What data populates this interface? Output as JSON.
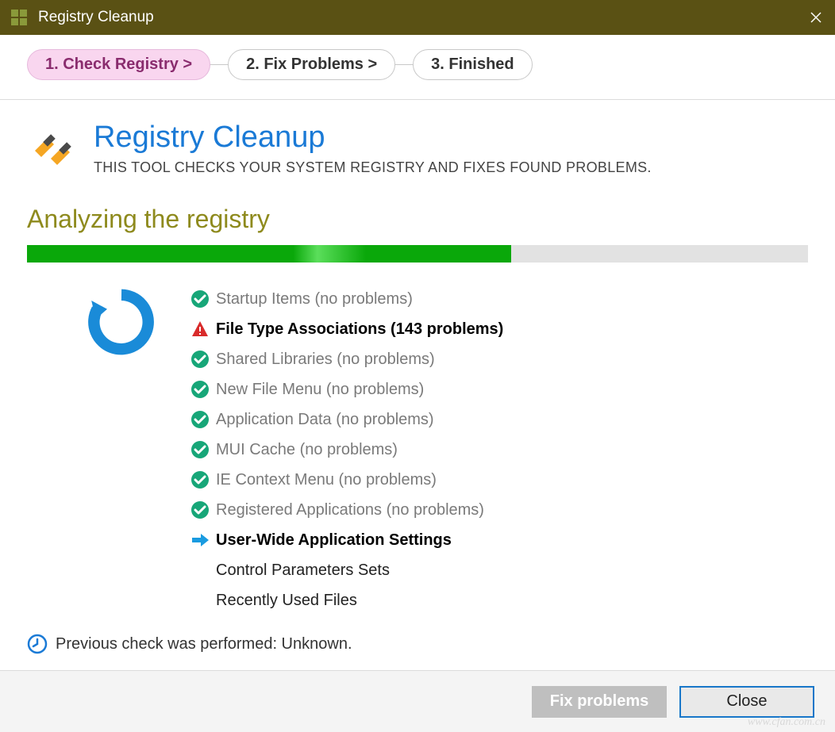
{
  "titlebar": {
    "title": "Registry Cleanup"
  },
  "steps": [
    {
      "label": "1. Check Registry >",
      "active": true
    },
    {
      "label": "2. Fix Problems >",
      "active": false
    },
    {
      "label": "3. Finished",
      "active": false
    }
  ],
  "header": {
    "title": "Registry Cleanup",
    "subtitle": "THIS TOOL CHECKS YOUR SYSTEM REGISTRY AND FIXES FOUND PROBLEMS."
  },
  "status_heading": "Analyzing the registry",
  "progress_percent": 62,
  "items": [
    {
      "label": "Startup Items (no problems)",
      "state": "ok"
    },
    {
      "label": "File Type Associations (143 problems)",
      "state": "error"
    },
    {
      "label": "Shared Libraries (no problems)",
      "state": "ok"
    },
    {
      "label": "New File Menu (no problems)",
      "state": "ok"
    },
    {
      "label": "Application Data (no problems)",
      "state": "ok"
    },
    {
      "label": "MUI Cache (no problems)",
      "state": "ok"
    },
    {
      "label": "IE Context Menu (no problems)",
      "state": "ok"
    },
    {
      "label": "Registered Applications (no problems)",
      "state": "ok"
    },
    {
      "label": "User-Wide Application Settings",
      "state": "current"
    },
    {
      "label": "Control Parameters Sets",
      "state": "pending"
    },
    {
      "label": "Recently Used Files",
      "state": "pending"
    }
  ],
  "previous_check": "Previous check was performed: Unknown.",
  "footer": {
    "fix_label": "Fix problems",
    "close_label": "Close"
  },
  "watermark": "www.cfan.com.cn"
}
